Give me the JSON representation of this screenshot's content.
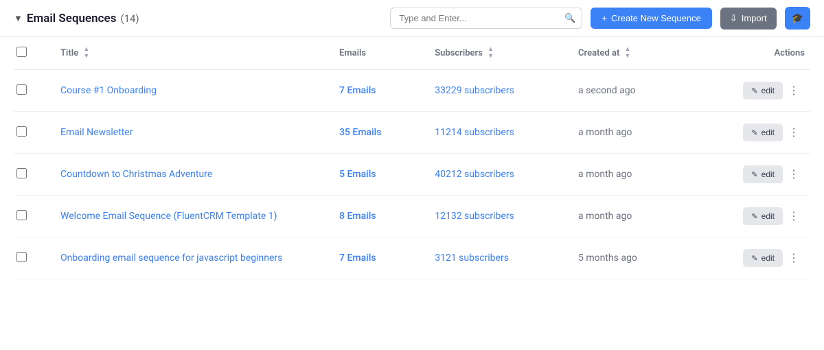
{
  "header": {
    "title": "Email Sequences",
    "count": "(14)",
    "search_placeholder": "Type and Enter...",
    "create_button": "Create New Sequence",
    "import_button": "Import"
  },
  "table": {
    "columns": {
      "title": "Title",
      "emails": "Emails",
      "subscribers": "Subscribers",
      "created_at": "Created at",
      "actions": "Actions"
    },
    "rows": [
      {
        "id": 1,
        "title": "Course #1 Onboarding",
        "emails": "7 Emails",
        "subscribers": "33229 subscribers",
        "created_at": "a second ago"
      },
      {
        "id": 2,
        "title": "Email Newsletter",
        "emails": "35 Emails",
        "subscribers": "11214 subscribers",
        "created_at": "a month ago"
      },
      {
        "id": 3,
        "title": "Countdown to Christmas Adventure",
        "emails": "5 Emails",
        "subscribers": "40212 subscribers",
        "created_at": "a month ago"
      },
      {
        "id": 4,
        "title": "Welcome Email Sequence (FluentCRM Template 1)",
        "emails": "8 Emails",
        "subscribers": "12132 subscribers",
        "created_at": "a month ago"
      },
      {
        "id": 5,
        "title": "Onboarding email sequence for javascript beginners",
        "emails": "7 Emails",
        "subscribers": "3121 subscribers",
        "created_at": "5 months ago"
      }
    ],
    "edit_label": "edit"
  }
}
